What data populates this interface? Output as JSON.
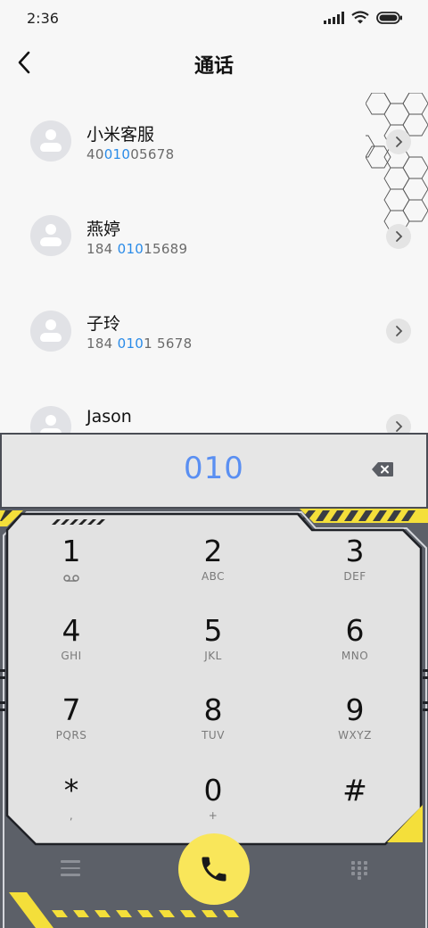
{
  "status_bar": {
    "time": "2:36"
  },
  "header": {
    "title": "通话"
  },
  "contacts": [
    {
      "name": "小米客服",
      "number_pre": "40",
      "number_match": "010",
      "number_post": "05678"
    },
    {
      "name": "燕婷",
      "number_pre": "184 ",
      "number_match": "010",
      "number_post": "15689"
    },
    {
      "name": "子玲",
      "number_pre": "184 ",
      "number_match": "010",
      "number_post": "1 5678"
    },
    {
      "name": "Jason",
      "number_pre": "",
      "number_match": "",
      "number_post": ""
    }
  ],
  "dialer": {
    "input_value": "010",
    "keys": [
      {
        "digit": "1",
        "letters": "",
        "icon": "voicemail-icon"
      },
      {
        "digit": "2",
        "letters": "ABC"
      },
      {
        "digit": "3",
        "letters": "DEF"
      },
      {
        "digit": "4",
        "letters": "GHI"
      },
      {
        "digit": "5",
        "letters": "JKL"
      },
      {
        "digit": "6",
        "letters": "MNO"
      },
      {
        "digit": "7",
        "letters": "PQRS"
      },
      {
        "digit": "8",
        "letters": "TUV"
      },
      {
        "digit": "9",
        "letters": "WXYZ"
      },
      {
        "digit": "*",
        "letters": ","
      },
      {
        "digit": "0",
        "letters": "+"
      },
      {
        "digit": "#",
        "letters": ""
      }
    ]
  },
  "bottom_bar": {
    "left_icon": "menu-icon",
    "center_icon": "phone-icon",
    "right_icon": "dialpad-grid-icon"
  },
  "colors": {
    "accent": "#2a8be8",
    "input_text": "#5a8ff2",
    "call_button": "#f9e65a",
    "frame": "#5c6068",
    "stripe": "#f4df3a"
  }
}
